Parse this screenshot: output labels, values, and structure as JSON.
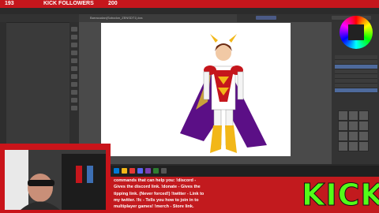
{
  "overlay": {
    "followers_current": "193",
    "followers_label": "KICK FOLLOWERS",
    "followers_goal": "200",
    "follower_progress": 0.965
  },
  "krita": {
    "document_tab_label": "Barracudan(Sobodon_ZENSDT1).kra",
    "accent_color": "#4e6a9c"
  },
  "chat": {
    "lines": [
      "commands that can help you: !discord -",
      "Gives the discord link. !donate - Gives the",
      "tipping link. (Never forced!) !twitter - Link to",
      "my twitter. !fc - Tells you how to join in to",
      "multiplayer games! !merch - Store link."
    ]
  },
  "brand": {
    "logo_text": "KICK",
    "logo_color": "#53fc18",
    "frame_color": "#c21a1e"
  }
}
